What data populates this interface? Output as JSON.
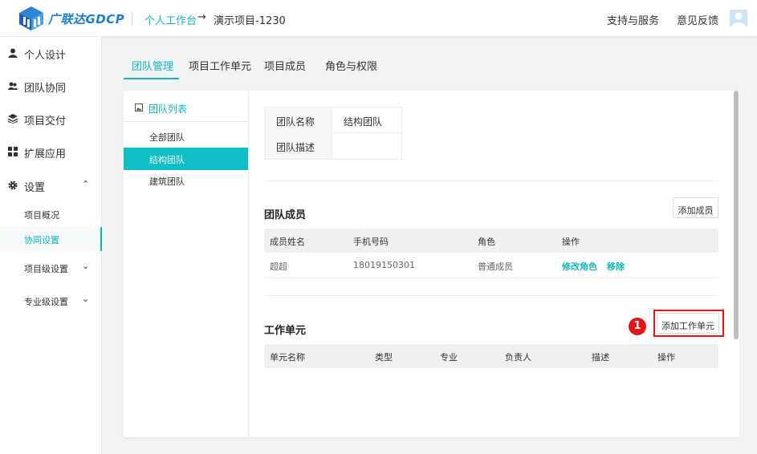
{
  "header": {
    "brand": "广联达GDCP",
    "breadcrumb_home": "个人工作台",
    "breadcrumb_arrow": "→",
    "breadcrumb_project": "演示项目-1230",
    "support": "支持与服务",
    "feedback": "意见反馈"
  },
  "sidebar": {
    "items": [
      {
        "label": "个人设计",
        "icon": "user-icon"
      },
      {
        "label": "团队协同",
        "icon": "team-icon"
      },
      {
        "label": "项目交付",
        "icon": "layers-icon"
      },
      {
        "label": "扩展应用",
        "icon": "grid-icon"
      },
      {
        "label": "设置",
        "icon": "gear-icon",
        "chevron": "⌃"
      }
    ],
    "sub_items": [
      {
        "label": "项目概况"
      },
      {
        "label": "协同设置"
      },
      {
        "label": "项目级设置",
        "chevron": "⌄"
      },
      {
        "label": "专业级设置",
        "chevron": "⌄"
      }
    ]
  },
  "tabs": [
    "团队管理",
    "项目工作单元",
    "项目成员",
    "角色与权限"
  ],
  "team_list": {
    "title": "团队列表",
    "items": [
      "全部团队",
      "结构团队",
      "建筑团队"
    ]
  },
  "team_info": {
    "name_key": "团队名称",
    "name_value": "结构团队",
    "desc_key": "团队描述",
    "desc_value": ""
  },
  "members": {
    "title": "团队成员",
    "add_button": "添加成员",
    "columns": [
      "成员姓名",
      "手机号码",
      "角色",
      "操作"
    ],
    "rows": [
      {
        "name": "超超",
        "phone": "18019150301",
        "role": "普通成员",
        "action_edit": "修改角色",
        "action_remove": "移除"
      }
    ]
  },
  "work_units": {
    "title": "工作单元",
    "add_button": "添加工作单元",
    "columns": [
      "单元名称",
      "类型",
      "专业",
      "负责人",
      "描述",
      "操作"
    ]
  },
  "annotation": {
    "step": "1"
  },
  "colors": {
    "accent": "#10b7bf",
    "highlight": "#e0161b"
  }
}
